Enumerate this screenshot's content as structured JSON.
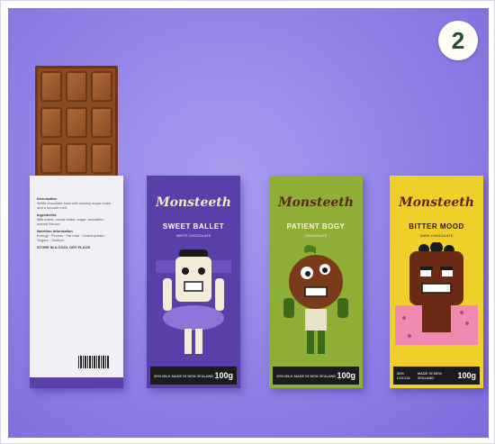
{
  "badge": {
    "number": "2"
  },
  "box": {
    "heading1": "Description",
    "heading2": "Ingredients",
    "heading3": "Nutrition Information",
    "storage": "STORE IN A COOL DRY PLACE",
    "body1": "White chocolate treat with creamy sugar notes and a smooth melt.",
    "body2": "Milk solids, cocoa butter, sugar, emulsifier, natural flavour.",
    "body3": "Energy · Protein · Fat total · Carbohydrate · Sugars · Sodium"
  },
  "bars": [
    {
      "logo": "Monsteeth",
      "name": "SWEET BALLET",
      "type": "WHITE CHOCOLATE",
      "percent": "30% MILK",
      "made": "MADE IN NEW ZEALAND",
      "weight": "100g",
      "color": "#5a3fa8"
    },
    {
      "logo": "Monsteeth",
      "name": "PATIENT BOGY",
      "type": "CHOCOLATE",
      "percent": "20% MILK",
      "made": "MADE IN NEW ZEALAND",
      "weight": "100g",
      "color": "#8fae35"
    },
    {
      "logo": "Monsteeth",
      "name": "BITTER MOOD",
      "type": "DARK CHOCOLATE",
      "percent": "50% COCOA",
      "made": "MADE IN NEW ZEALAND",
      "weight": "100g",
      "color": "#efd02a"
    }
  ],
  "icons": {
    "brand_mark": "chocolate-square-icon"
  }
}
